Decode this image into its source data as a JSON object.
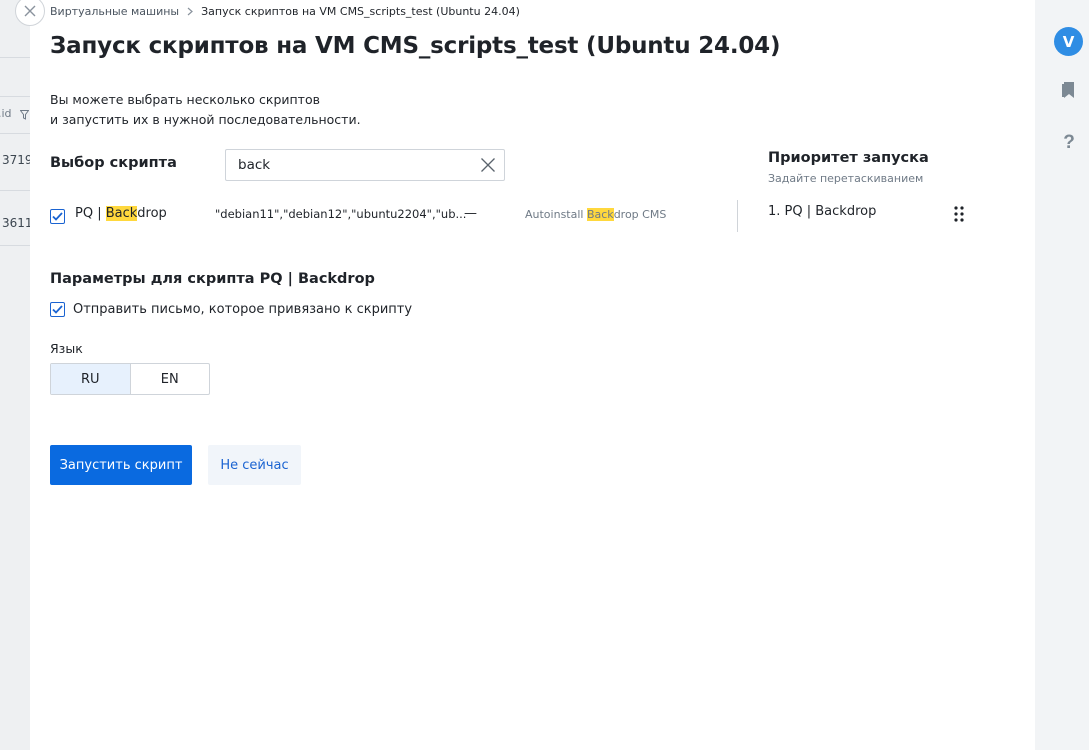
{
  "background": {
    "col_header": ".id",
    "rows": [
      "3719",
      "3611"
    ]
  },
  "breadcrumb": {
    "parent": "Виртуальные машины",
    "current": "Запуск скриптов на VM CMS_scripts_test (Ubuntu 24.04)"
  },
  "title": "Запуск скриптов на VM CMS_scripts_test (Ubuntu 24.04)",
  "description": {
    "line1": "Вы можете выбрать несколько скриптов",
    "line2": "и запустить их в нужной последовательности."
  },
  "script_select": {
    "label": "Выбор скрипта",
    "search_value": "back"
  },
  "scripts": [
    {
      "checked": true,
      "name_prefix": "PQ | ",
      "name_match": "Back",
      "name_suffix": "drop",
      "os": "\"debian11\",\"debian12\",\"ubuntu2204\",\"ub...",
      "dash": "—",
      "desc_prefix": "Autoinstall ",
      "desc_match": "Back",
      "desc_suffix": "drop CMS"
    }
  ],
  "priority": {
    "title": "Приоритет запуска",
    "hint": "Задайте перетаскиванием",
    "items": [
      "1.  PQ | Backdrop"
    ]
  },
  "params": {
    "title": "Параметры для скрипта PQ | Backdrop",
    "send_email_label": "Отправить письмо, которое привязано к скрипту",
    "send_email_checked": true,
    "language_label": "Язык",
    "languages": [
      "RU",
      "EN"
    ],
    "language_selected": "RU"
  },
  "actions": {
    "run": "Запустить скрипт",
    "cancel": "Не сейчас"
  },
  "user": {
    "avatar_letter": "V"
  },
  "colors": {
    "primary": "#0a6ae0",
    "highlight": "#ffd83d",
    "avatar": "#2f8de4"
  }
}
